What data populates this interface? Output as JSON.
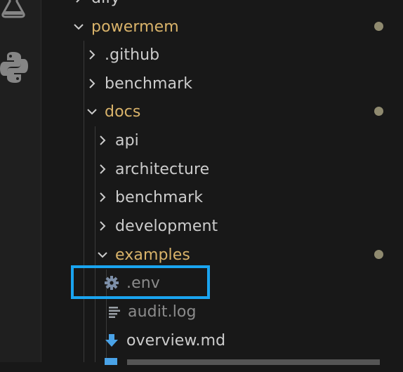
{
  "activity_bar": {
    "icons": [
      "flask-icon",
      "python-icon"
    ]
  },
  "explorer": {
    "items": [
      {
        "label": "dify",
        "type": "folder",
        "expanded": false,
        "level": 0
      },
      {
        "label": "powermem",
        "type": "folder",
        "expanded": true,
        "modified": true,
        "level": 0
      },
      {
        "label": ".github",
        "type": "folder",
        "expanded": false,
        "level": 1
      },
      {
        "label": "benchmark",
        "type": "folder",
        "expanded": false,
        "level": 1
      },
      {
        "label": "docs",
        "type": "folder",
        "expanded": true,
        "modified": true,
        "level": 1
      },
      {
        "label": "api",
        "type": "folder",
        "expanded": false,
        "level": 2
      },
      {
        "label": "architecture",
        "type": "folder",
        "expanded": false,
        "level": 2
      },
      {
        "label": "benchmark",
        "type": "folder",
        "expanded": false,
        "level": 2
      },
      {
        "label": "development",
        "type": "folder",
        "expanded": false,
        "level": 2
      },
      {
        "label": "examples",
        "type": "folder",
        "expanded": true,
        "modified": true,
        "level": 2
      },
      {
        "label": ".env",
        "type": "file",
        "icon": "gear-icon",
        "ignored": true,
        "level": 3
      },
      {
        "label": "audit.log",
        "type": "file",
        "icon": "lines-icon",
        "ignored": true,
        "level": 3
      },
      {
        "label": "overview.md",
        "type": "file",
        "icon": "markdown-arrow-icon",
        "level": 3
      }
    ],
    "highlight_color": "#1aa4f0",
    "modified_color": "#d9b36a"
  }
}
